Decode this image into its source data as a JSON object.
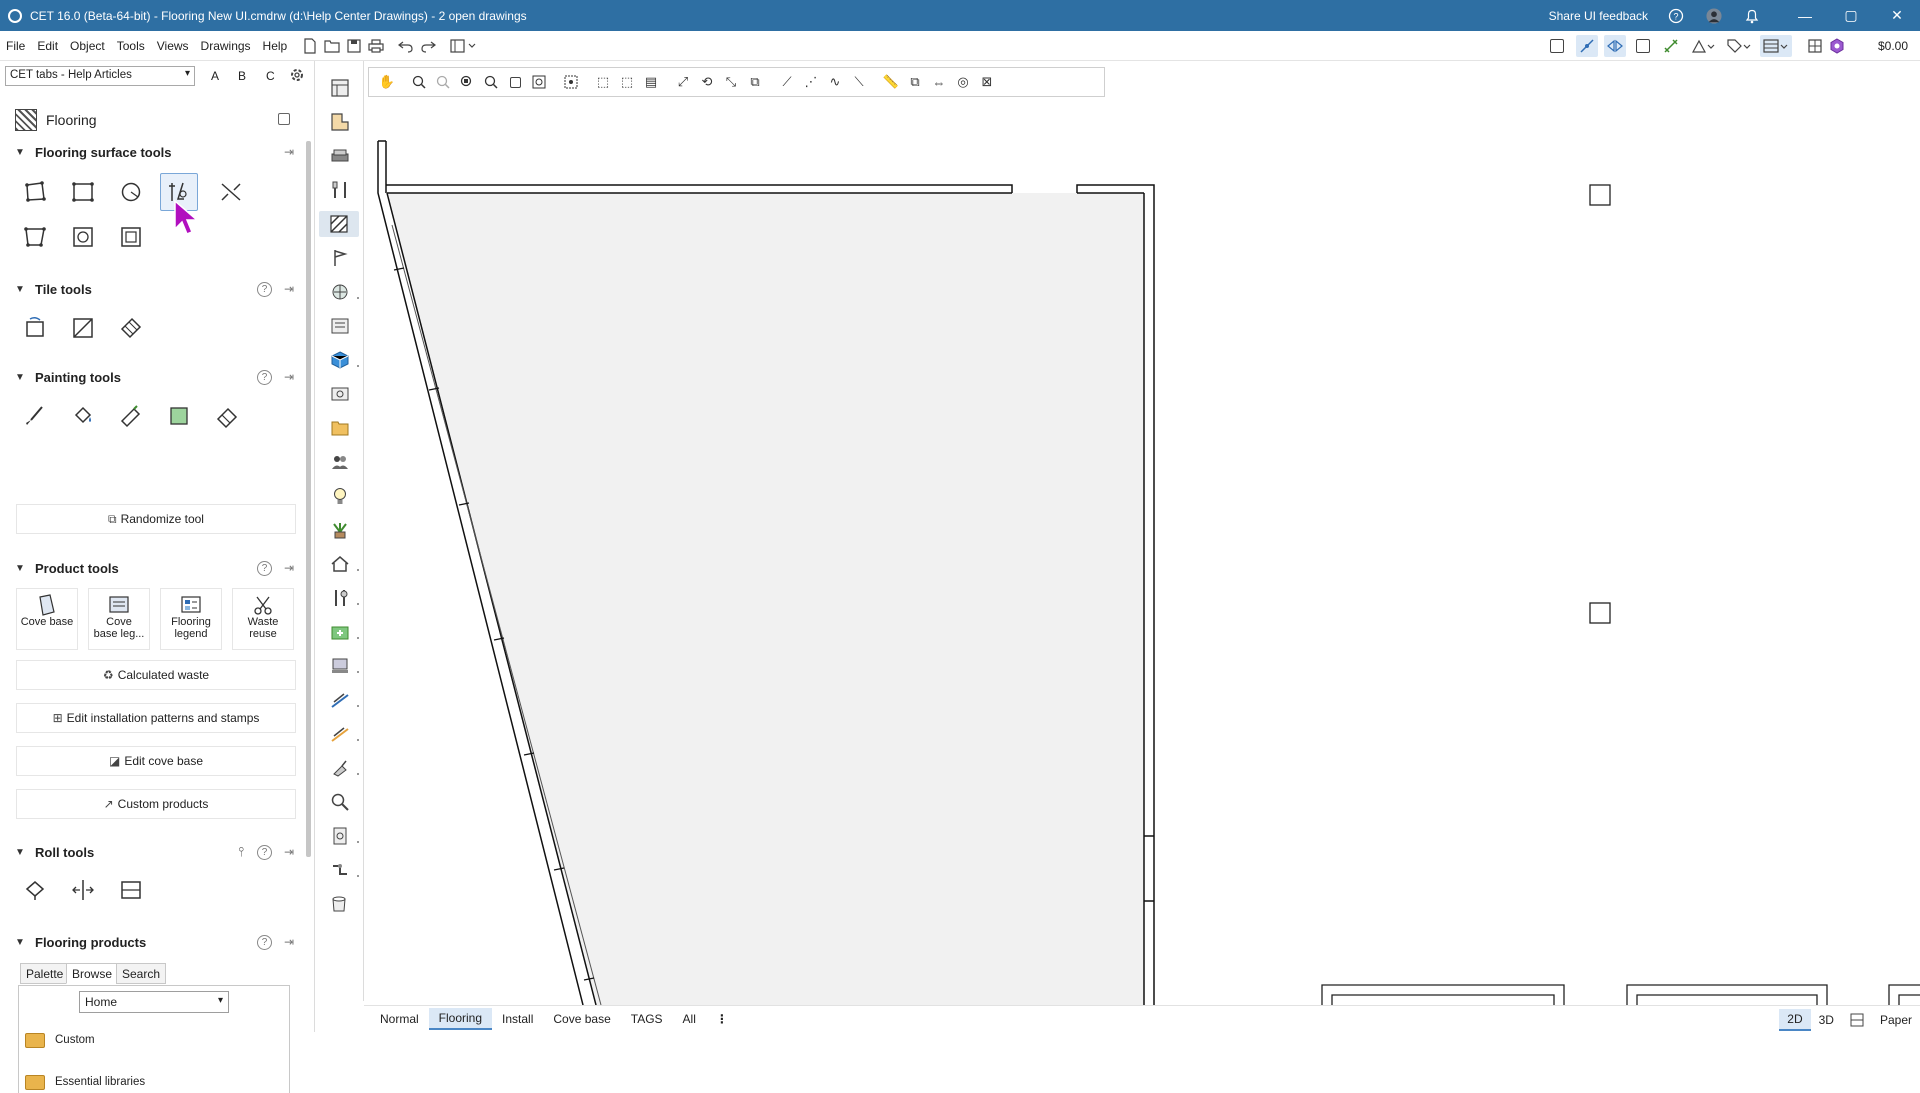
{
  "window": {
    "title": "CET 16.0 (Beta-64-bit) - Flooring New UI.cmdrw (d:\\Help Center Drawings) - 2  open drawings",
    "feedback": "Share UI feedback",
    "minimize": "—",
    "maximize": "▢",
    "close": "✕"
  },
  "menu": {
    "items": [
      "File",
      "Edit",
      "Object",
      "Tools",
      "Views",
      "Drawings",
      "Help"
    ],
    "price": "$0.00"
  },
  "left_panel": {
    "tab_selector": "CET tabs - Help Articles",
    "letters": [
      "A",
      "B",
      "C"
    ],
    "header": "Flooring",
    "sections": {
      "surface": "Flooring surface tools",
      "tile": "Tile tools",
      "painting": "Painting tools",
      "product": "Product tools",
      "roll": "Roll tools",
      "flooring_products": "Flooring products"
    },
    "help_glyph": "?",
    "buttons": {
      "randomize": "Randomize tool",
      "calculated_waste": "Calculated waste",
      "edit_patterns": "Edit installation patterns and stamps",
      "edit_cove": "Edit cove base",
      "custom_products": "Custom products"
    },
    "product_tiles": [
      {
        "line1": "Cove base",
        "line2": ""
      },
      {
        "line1": "Cove",
        "line2": "base leg..."
      },
      {
        "line1": "Flooring",
        "line2": "legend"
      },
      {
        "line1": "Waste",
        "line2": "reuse"
      }
    ],
    "product_tabs": [
      "Palette",
      "Browse",
      "Search"
    ],
    "browse_select": "Home",
    "folders": [
      "Custom",
      "Essential libraries"
    ]
  },
  "bottom_tabs": [
    "Normal",
    "Flooring",
    "Install",
    "Cove base",
    "TAGS",
    "All"
  ],
  "bottom_more": "⋮",
  "view_modes": [
    "2D",
    "3D",
    "Paper"
  ],
  "colors": {
    "titlebar": "#2e6fa3",
    "accent": "#4a86c5",
    "selected_bg": "#dbe8f6",
    "floor_fill": "#f1f1f1",
    "cursor": "#b10fbf"
  }
}
